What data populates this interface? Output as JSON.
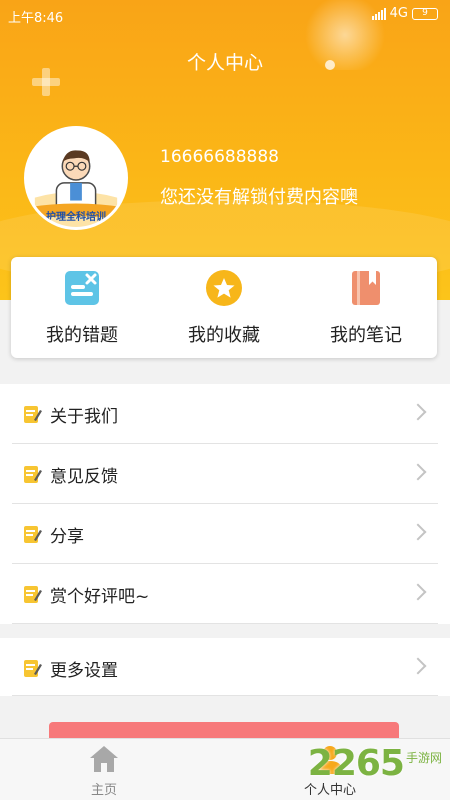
{
  "status_bar": {
    "time": "上午8:46",
    "network": "4G",
    "battery": "9"
  },
  "header": {
    "title": "个人中心"
  },
  "profile": {
    "avatar_caption": "护理全科培训",
    "phone": "16666688888",
    "description": "您还没有解锁付费内容噢"
  },
  "quick_actions": [
    {
      "label": "我的错题",
      "icon": "wrong-questions-icon",
      "color": "#5ec4e6"
    },
    {
      "label": "我的收藏",
      "icon": "star-icon",
      "color": "#f7b61a"
    },
    {
      "label": "我的笔记",
      "icon": "notebook-icon",
      "color": "#ef8f6d"
    }
  ],
  "menu": {
    "items": [
      {
        "label": "关于我们"
      },
      {
        "label": "意见反馈"
      },
      {
        "label": "分享"
      },
      {
        "label": "赏个好评吧~"
      }
    ],
    "settings": {
      "label": "更多设置"
    }
  },
  "tabbar": {
    "home_label": "主页",
    "me_label": "个人中心"
  },
  "watermark": {
    "number": "2265",
    "suffix": "手游网"
  },
  "colors": {
    "header_top": "#f9a417",
    "header_bottom": "#fcc41a",
    "accent_red": "#f7797a",
    "active_tab": "#f7a81b"
  }
}
